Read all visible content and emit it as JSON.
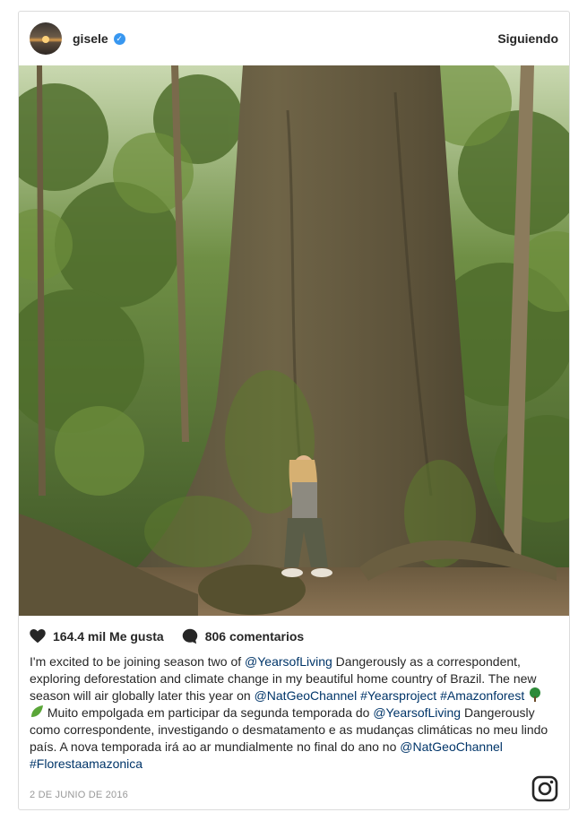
{
  "post": {
    "username": "gisele",
    "follow_label": "Siguiendo",
    "likes": "164.4 mil Me gusta",
    "comments": "806 comentarios",
    "date": "2 DE JUNIO DE 2016",
    "caption": {
      "t1": "I'm excited to be joining season two of ",
      "m1": "@YearsofLiving",
      "t2": " Dangerously as a correspondent, exploring deforestation and climate change in my beautiful home country of Brazil. The new season will air globally later this year on ",
      "m2": "@NatGeoChannel",
      "h1": "#Yearsproject",
      "h2": "#Amazonforest",
      "t3": " Muito empolgada em participar da segunda temporada do ",
      "m3": "@YearsofLiving",
      "t4": " Dangerously como correspondente, investigando o desmatamento e as mudanças climáticas no meu lindo país. A nova temporada irá ao ar mundialmente no final do ano no ",
      "m4": "@NatGeoChannel",
      "h3": "#Florestaamazonica"
    }
  },
  "icons": {
    "verified": "verified-badge-icon",
    "like": "heart-icon",
    "comment": "comment-icon",
    "brand": "instagram-icon"
  },
  "colors": {
    "link": "#003569",
    "verified": "#3897f0",
    "border": "#dbdbdb"
  }
}
